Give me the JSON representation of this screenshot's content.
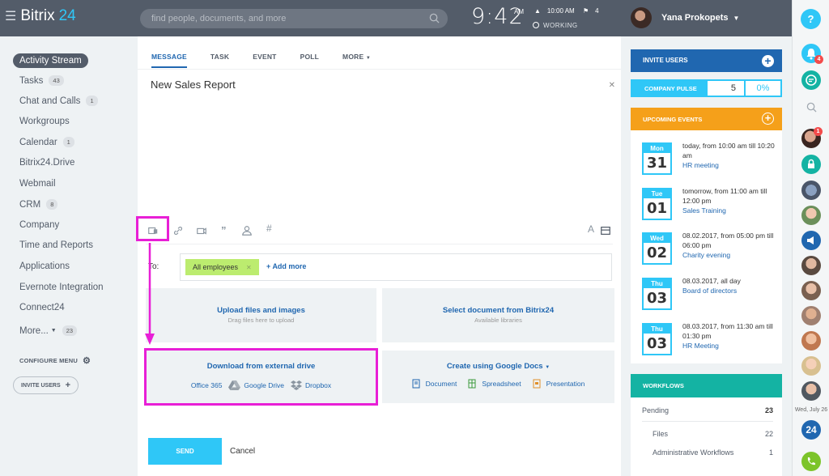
{
  "header": {
    "brand_a": "Bitrix",
    "brand_b": "24",
    "search_placeholder": "find people, documents, and more",
    "clock": "9:42",
    "ampm": "AM",
    "alarm_time": "10:00 AM",
    "flag_count": "4",
    "status": "WORKING",
    "user_name": "Yana Prokopets"
  },
  "sidebar": {
    "items": [
      {
        "label": "Activity Stream",
        "counter": null
      },
      {
        "label": "Tasks",
        "counter": "43"
      },
      {
        "label": "Chat and Calls",
        "counter": "1"
      },
      {
        "label": "Workgroups",
        "counter": null
      },
      {
        "label": "Calendar",
        "counter": "1"
      },
      {
        "label": "Bitrix24.Drive",
        "counter": null
      },
      {
        "label": "Webmail",
        "counter": null
      },
      {
        "label": "CRM",
        "counter": "8"
      },
      {
        "label": "Company",
        "counter": null
      },
      {
        "label": "Time and Reports",
        "counter": null
      },
      {
        "label": "Applications",
        "counter": null
      },
      {
        "label": "Evernote Integration",
        "counter": null
      },
      {
        "label": "Connect24",
        "counter": null
      },
      {
        "label": "More...",
        "counter": "23"
      }
    ],
    "configure_menu": "CONFIGURE MENU",
    "invite_users": "INVITE USERS"
  },
  "composer": {
    "tabs": [
      "MESSAGE",
      "TASK",
      "EVENT",
      "POLL",
      "MORE"
    ],
    "title": "New Sales Report",
    "to_label": "To:",
    "recipient": "All employees",
    "add_more": "Add more",
    "upload_title": "Upload files and images",
    "upload_sub": "Drag files here to upload",
    "bitrix_title": "Select document from Bitrix24",
    "bitrix_sub": "Available libraries",
    "external_title": "Download from external drive",
    "external_links": [
      "Office 365",
      "Google Drive",
      "Dropbox"
    ],
    "gdocs_title": "Create using Google Docs",
    "gdocs_links": [
      "Document",
      "Spreadsheet",
      "Presentation"
    ],
    "send": "SEND",
    "cancel": "Cancel"
  },
  "widgets": {
    "invite_users": "INVITE USERS",
    "company_pulse": "COMPANY PULSE",
    "pulse_value": "5",
    "pulse_percent": "0%",
    "upcoming_events": "UPCOMING EVENTS",
    "events": [
      {
        "day": "Mon",
        "num": "31",
        "when": "today, from 10:00 am till 10:20 am",
        "title": "HR meeting"
      },
      {
        "day": "Tue",
        "num": "01",
        "when": "tomorrow, from 11:00 am till 12:00 pm",
        "title": "Sales Training"
      },
      {
        "day": "Wed",
        "num": "02",
        "when": "08.02.2017, from 05:00 pm till 06:00 pm",
        "title": "Charity evening"
      },
      {
        "day": "Thu",
        "num": "03",
        "when": "08.03.2017, all day",
        "title": "Board of directors"
      },
      {
        "day": "Thu",
        "num": "03",
        "when": "08.03.2017, from 11:30 am till 01:30 pm",
        "title": "HR Meeting"
      }
    ],
    "workflows": "WORKFLOWS",
    "wf_rows": [
      {
        "label": "Pending",
        "value": "23"
      },
      {
        "label": "Files",
        "value": "22"
      },
      {
        "label": "Administrative Workflows",
        "value": "1"
      }
    ]
  },
  "right_strip": {
    "help": "?",
    "notif_badge": "4",
    "user_badge": "1",
    "date": "Wed, July 26",
    "b24": "24"
  }
}
